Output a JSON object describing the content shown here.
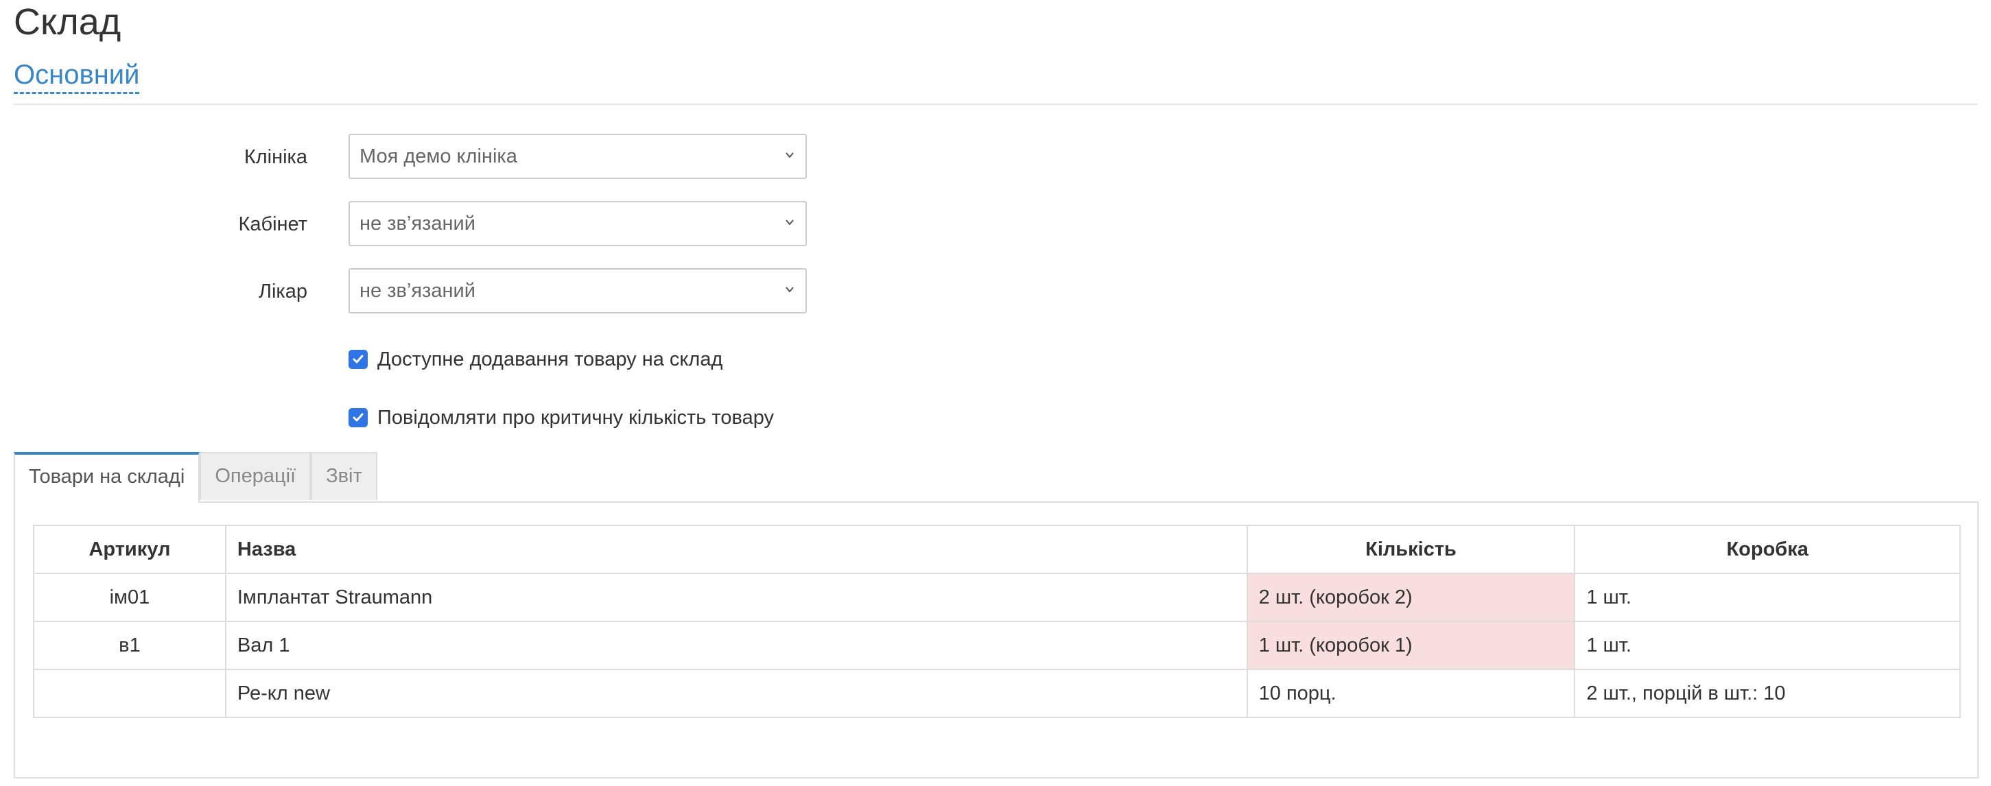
{
  "page": {
    "title": "Склад",
    "section_link": "Основний"
  },
  "form": {
    "clinic": {
      "label": "Клініка",
      "value": "Моя демо клініка"
    },
    "cabinet": {
      "label": "Кабінет",
      "value": "не зв’язаний"
    },
    "doctor": {
      "label": "Лікар",
      "value": "не зв’язаний"
    },
    "allow_add": {
      "label": "Доступне додавання товару на склад",
      "checked": true
    },
    "notify_critical": {
      "label": "Повідомляти про критичну кількість товару",
      "checked": true
    }
  },
  "tabs": [
    {
      "label": "Товари на складі",
      "active": true
    },
    {
      "label": "Операції",
      "active": false
    },
    {
      "label": "Звіт",
      "active": false
    }
  ],
  "table": {
    "headers": {
      "sku": "Артикул",
      "name": "Назва",
      "qty": "Кількість",
      "box": "Коробка"
    },
    "rows": [
      {
        "sku": "ім01",
        "name": "Імплантат Straumann",
        "qty": "2 шт. (коробок 2)",
        "box": "1 шт.",
        "critical": true
      },
      {
        "sku": "в1",
        "name": "Вал 1",
        "qty": "1 шт. (коробок 1)",
        "box": "1 шт.",
        "critical": true
      },
      {
        "sku": "",
        "name": "Ре-кл new",
        "qty": "10 порц.",
        "box": "2 шт., порцій в шт.: 10",
        "critical": false
      }
    ]
  },
  "colors": {
    "accent": "#3a87c8",
    "checkbox": "#2f75e6",
    "critical_bg": "#f8dede"
  },
  "icons": {
    "select_arrow": "chevron-down-icon",
    "checkbox": "checkmark-icon"
  }
}
